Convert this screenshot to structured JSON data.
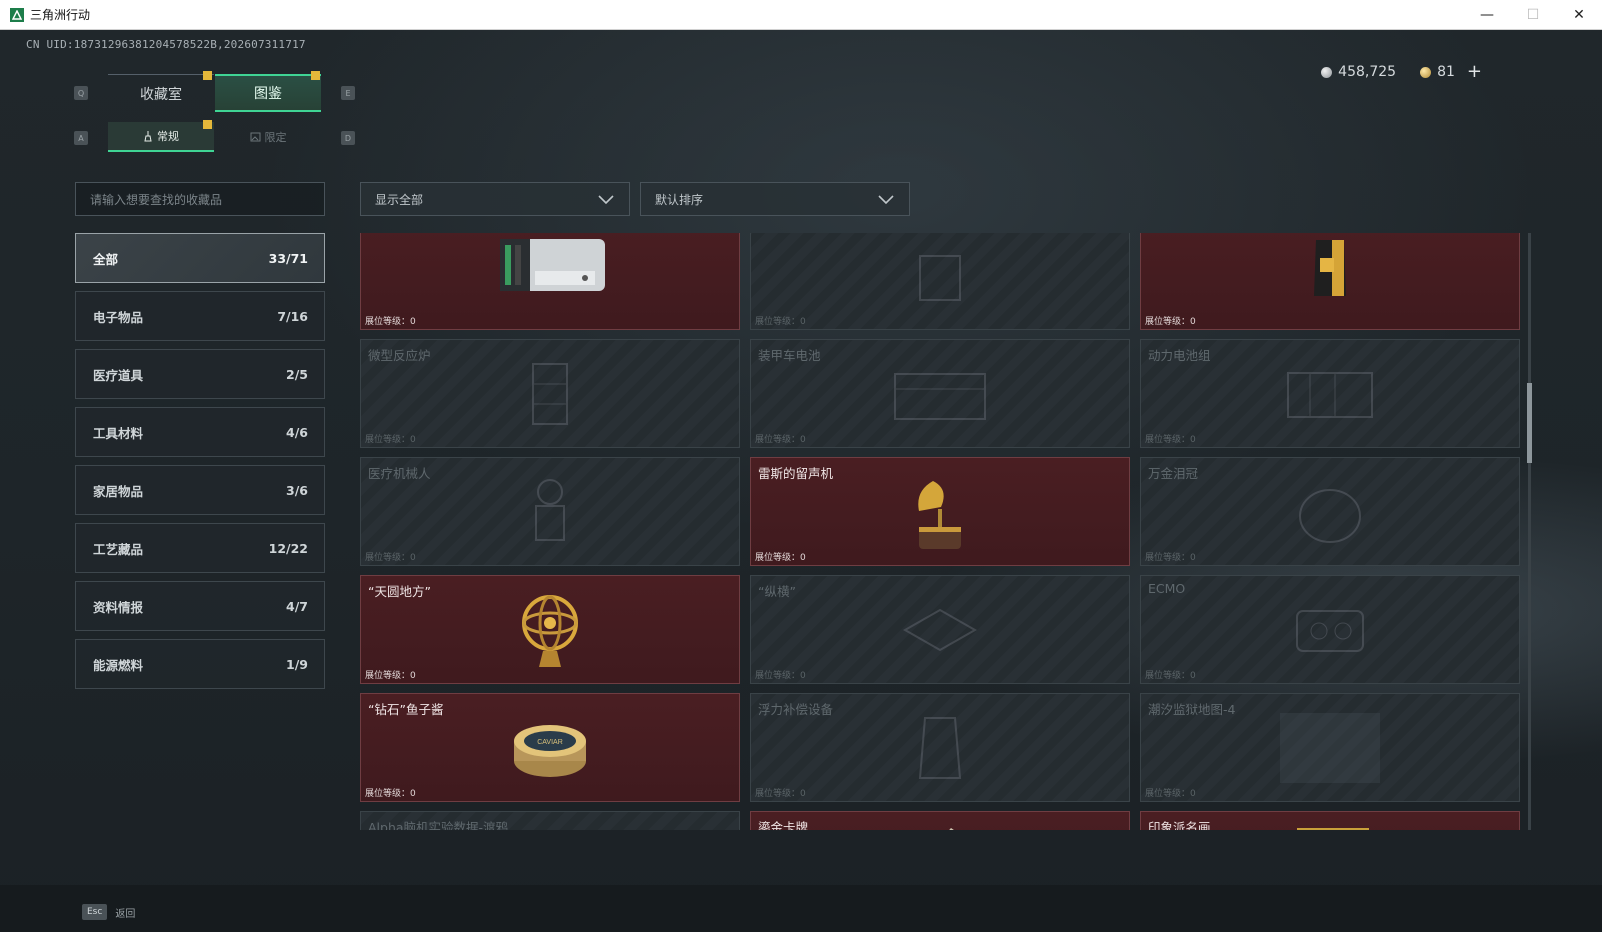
{
  "window": {
    "title": "三角洲行动",
    "controls": {
      "minimize": "—",
      "maximize": "☐",
      "close": "✕"
    }
  },
  "uid": "CN UID:18731296381204578522B,202607311717",
  "currency": {
    "silver": "458,725",
    "gold": "81",
    "plus": "+"
  },
  "tabs": {
    "prev_key": "Q",
    "next_key": "E",
    "main": [
      {
        "label": "收藏室"
      },
      {
        "label": "图鉴"
      }
    ],
    "sub_prev_key": "A",
    "sub_next_key": "D",
    "sub": [
      {
        "label": "常规"
      },
      {
        "label": "限定"
      }
    ]
  },
  "search": {
    "placeholder": "请输入想要查找的收藏品"
  },
  "filters": {
    "show": "显示全部",
    "sort": "默认排序"
  },
  "categories": [
    {
      "label": "全部",
      "count": "33/71"
    },
    {
      "label": "电子物品",
      "count": "7/16"
    },
    {
      "label": "医疗道具",
      "count": "2/5"
    },
    {
      "label": "工具材料",
      "count": "4/6"
    },
    {
      "label": "家居物品",
      "count": "3/6"
    },
    {
      "label": "工艺藏品",
      "count": "12/22"
    },
    {
      "label": "资料情报",
      "count": "4/7"
    },
    {
      "label": "能源燃料",
      "count": "1/9"
    }
  ],
  "level_label": "展位等级：",
  "items": [
    {
      "name": "",
      "level": "0",
      "owned": true,
      "icon": "gpu-icon"
    },
    {
      "name": "",
      "level": "0",
      "owned": false,
      "icon": "generic-item-icon"
    },
    {
      "name": "",
      "level": "0",
      "owned": true,
      "icon": "coffee-bag-icon"
    },
    {
      "name": "微型反应炉",
      "level": "0",
      "owned": false,
      "icon": "reactor-icon"
    },
    {
      "name": "装甲车电池",
      "level": "0",
      "owned": false,
      "icon": "battery-icon"
    },
    {
      "name": "动力电池组",
      "level": "0",
      "owned": false,
      "icon": "battery-pack-icon"
    },
    {
      "name": "医疗机械人",
      "level": "0",
      "owned": false,
      "icon": "robot-icon"
    },
    {
      "name": "雷斯的留声机",
      "level": "0",
      "owned": true,
      "icon": "gramophone-icon"
    },
    {
      "name": "万金泪冠",
      "level": "0",
      "owned": false,
      "icon": "crown-icon"
    },
    {
      "name": "“天圆地方”",
      "level": "0",
      "owned": true,
      "icon": "armillary-sphere-icon"
    },
    {
      "name": "“纵横”",
      "level": "0",
      "owned": false,
      "icon": "board-game-icon"
    },
    {
      "name": "ECMO",
      "level": "0",
      "owned": false,
      "icon": "ecmo-machine-icon"
    },
    {
      "name": "“钻石”鱼子酱",
      "level": "0",
      "owned": true,
      "icon": "caviar-tin-icon"
    },
    {
      "name": "浮力补偿设备",
      "level": "0",
      "owned": false,
      "icon": "bcd-vest-icon"
    },
    {
      "name": "潮汐监狱地图-4",
      "level": "0",
      "owned": false,
      "icon": "map-icon"
    },
    {
      "name": "Alpha脑机实验数据-渡鸦",
      "level": "",
      "owned": false,
      "icon": "data-drive-icon"
    },
    {
      "name": "鎏金卡牌",
      "level": "",
      "owned": true,
      "icon": "gold-card-icon"
    },
    {
      "name": "印象派名画",
      "level": "",
      "owned": true,
      "icon": "painting-icon"
    }
  ],
  "caviar_text": "CAVIAR",
  "footer": {
    "esc_key": "Esc",
    "back_label": "返回"
  },
  "colors": {
    "accent": "#3fd494",
    "owned_card": "#4a1e22",
    "marker": "#e5b83a"
  }
}
